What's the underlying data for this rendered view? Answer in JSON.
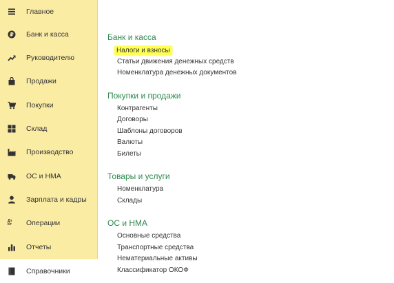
{
  "sidebar": {
    "items": [
      {
        "label": "Главное",
        "icon": "menu-lines-icon"
      },
      {
        "label": "Банк и касса",
        "icon": "ruble-coin-icon"
      },
      {
        "label": "Руководителю",
        "icon": "trend-arrow-icon"
      },
      {
        "label": "Продажи",
        "icon": "shopping-bag-icon"
      },
      {
        "label": "Покупки",
        "icon": "shopping-cart-icon"
      },
      {
        "label": "Склад",
        "icon": "warehouse-grid-icon"
      },
      {
        "label": "Производство",
        "icon": "factory-icon"
      },
      {
        "label": "ОС и НМА",
        "icon": "truck-icon"
      },
      {
        "label": "Зарплата и кадры",
        "icon": "person-icon"
      },
      {
        "label": "Операции",
        "icon": "debit-credit-icon",
        "icon_text": "Дт Кт"
      },
      {
        "label": "Отчеты",
        "icon": "bar-chart-icon"
      },
      {
        "label": "Справочники",
        "icon": "book-icon",
        "active": true
      }
    ]
  },
  "sections": [
    {
      "title": "Банк и касса",
      "links": [
        "Налоги и взносы",
        "Статьи движения денежных средств",
        "Номенклатура денежных документов"
      ]
    },
    {
      "title": "Покупки и продажи",
      "links": [
        "Контрагенты",
        "Договоры",
        "Шаблоны договоров",
        "Валюты",
        "Билеты"
      ]
    },
    {
      "title": "Товары и услуги",
      "links": [
        "Номенклатура",
        "Склады"
      ]
    },
    {
      "title": "ОС и НМА",
      "links": [
        "Основные средства",
        "Транспортные средства",
        "Нематериальные активы",
        "Классификатор ОКОФ"
      ]
    }
  ],
  "colors": {
    "sidebar_bg": "#fbeca4",
    "section_title": "#2d8a4e",
    "highlight": "#ffff55"
  }
}
